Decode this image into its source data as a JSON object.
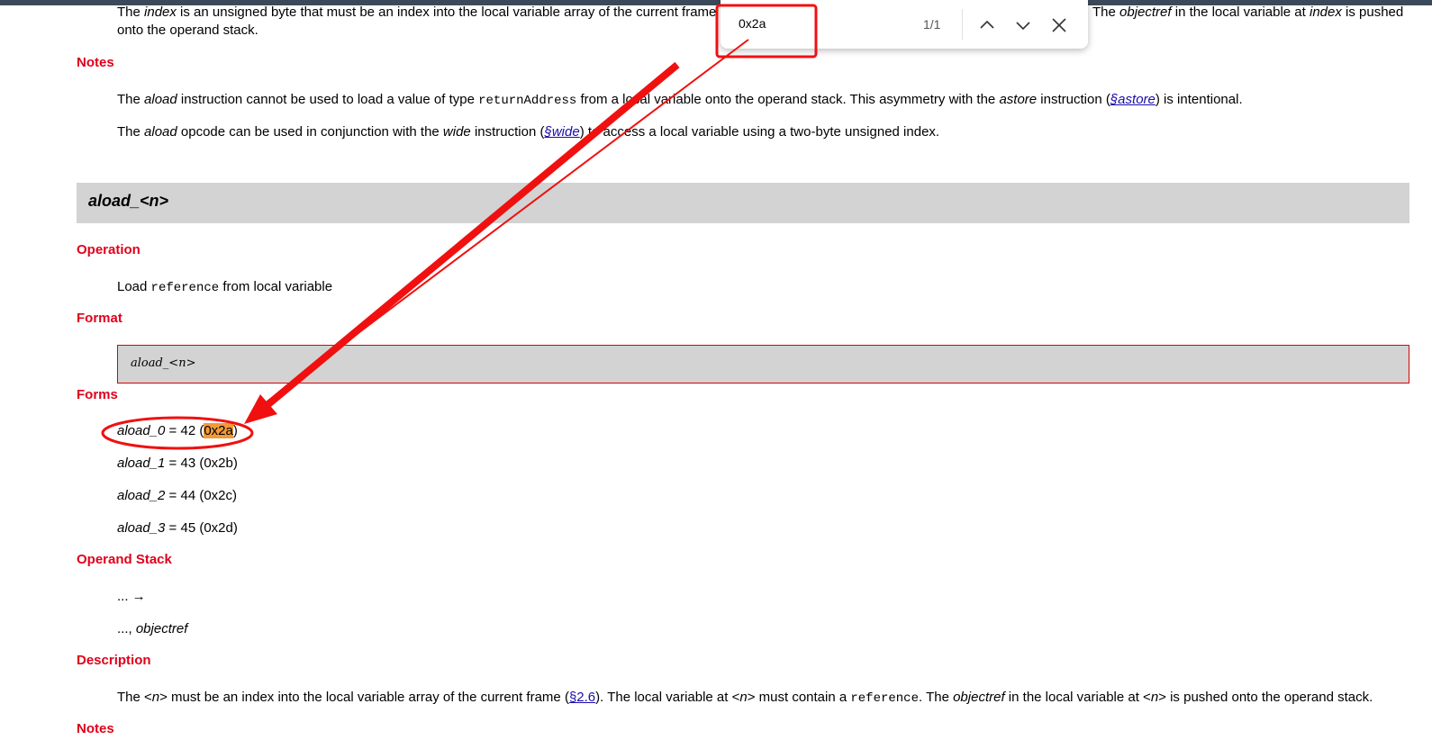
{
  "description_top": {
    "part1_pre": "The ",
    "part1_italic": "index",
    "part1_post": " is an unsigned byte that must be an index into the local variable array of the current frame",
    "part2_pre": "The ",
    "part2_italic": "objectref",
    "part2_mid": " in the local variable at ",
    "part2_italic2": "index",
    "part2_post": " is pushed",
    "line2": "onto the operand stack."
  },
  "notes1": {
    "heading": "Notes",
    "p1_a": "The ",
    "p1_b": "aload",
    "p1_c": " instruction cannot be used to load a value of type ",
    "p1_d": "returnAddress",
    "p1_e": " from a local variable onto the operand stack. This asymmetry with the ",
    "p1_f": "astore",
    "p1_g": " instruction (",
    "p1_link": "§astore",
    "p1_h": ") is intentional.",
    "p2_a": "The ",
    "p2_b": "aload",
    "p2_c": " opcode can be used in conjunction with the ",
    "p2_d": "wide",
    "p2_e": " instruction (",
    "p2_link": "§wide",
    "p2_f": ") to access a local variable using a two-byte unsigned index."
  },
  "section": {
    "title": "aload_<n>"
  },
  "operation": {
    "heading": "Operation",
    "a": "Load ",
    "b": "reference",
    "c": " from local variable"
  },
  "format": {
    "heading": "Format",
    "text": "aload_<n>"
  },
  "forms": {
    "heading": "Forms",
    "items": [
      {
        "name": "aload_0",
        "mid": " = 42 (",
        "hex": "0x2a",
        "end": ")"
      },
      {
        "name": "aload_1",
        "mid": " = 43 (",
        "hex": "0x2b",
        "end": ")"
      },
      {
        "name": "aload_2",
        "mid": " = 44 (",
        "hex": "0x2c",
        "end": ")"
      },
      {
        "name": "aload_3",
        "mid": " = 45 (",
        "hex": "0x2d",
        "end": ")"
      }
    ]
  },
  "operand_stack": {
    "heading": "Operand Stack",
    "before": "... →",
    "after_a": "..., ",
    "after_b": "objectref"
  },
  "description": {
    "heading": "Description",
    "a": "The <",
    "b": "n",
    "c": "> must be an index into the local variable array of the current frame (",
    "link": "§2.6",
    "d": "). The local variable at <",
    "e": "n",
    "f": "> must contain a ",
    "g": "reference",
    "h": ". The ",
    "i": "objectref",
    "j": " in the local variable at <",
    "k": "n",
    "l": "> is pushed onto the operand stack."
  },
  "notes2": {
    "heading": "Notes"
  },
  "findbar": {
    "query": "0x2a",
    "count": "1/1",
    "icons": {
      "prev": "chevron-up-icon",
      "next": "chevron-down-icon",
      "close": "close-icon"
    }
  },
  "colors": {
    "heading_red": "#e0001b",
    "annotation_red": "#f01010",
    "highlight": "#f29a38",
    "link": "#1a0dab",
    "section_gray": "#d3d3d3"
  }
}
